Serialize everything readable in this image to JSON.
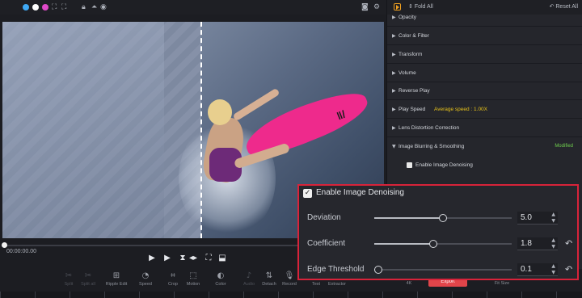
{
  "preview_toolbar": {
    "icons": [
      "record-dot-icon",
      "color-dot-icon",
      "mask-dot-icon",
      "crop-view-icon",
      "split-view-icon",
      "lock-icon",
      "mirror-icon",
      "eye-icon"
    ],
    "right_icons": [
      "snapshot-icon",
      "settings-icon"
    ]
  },
  "player": {
    "timecode": "00:00:00.00",
    "controls": [
      "play-icon",
      "step-play-icon",
      "trim-icon",
      "fullscreen-icon",
      "marker-icon"
    ]
  },
  "toolbar": {
    "items": [
      {
        "label": "Split",
        "icon": "scissors-icon",
        "enabled": false
      },
      {
        "label": "Split all",
        "icon": "split-all-icon",
        "enabled": false
      },
      {
        "label": "Ripple Edit",
        "icon": "ripple-edit-icon",
        "enabled": true
      },
      {
        "label": "Speed",
        "icon": "speed-icon",
        "enabled": true
      },
      {
        "label": "Crop",
        "icon": "crop-icon",
        "enabled": true
      },
      {
        "label": "Motion",
        "icon": "motion-icon",
        "enabled": true
      },
      {
        "label": "Color",
        "icon": "color-icon",
        "enabled": true
      },
      {
        "label": "Audio",
        "icon": "audio-icon",
        "enabled": false
      },
      {
        "label": "Detach",
        "icon": "detach-icon",
        "enabled": true
      },
      {
        "label": "Record",
        "icon": "mic-icon",
        "enabled": true
      },
      {
        "label": "Text",
        "icon": "text-icon",
        "enabled": true
      },
      {
        "label": "Extractor",
        "icon": "extractor-icon",
        "enabled": true
      }
    ],
    "right_labels": [
      "4K",
      "Fit Size"
    ],
    "export_label": "Export"
  },
  "panel": {
    "fold_label": "Fold All",
    "reset_label": "Reset All",
    "sections": [
      {
        "label": "Opacity"
      },
      {
        "label": "Color & Filter"
      },
      {
        "label": "Transform"
      },
      {
        "label": "Volume"
      },
      {
        "label": "Reverse Play"
      },
      {
        "label": "Play Speed",
        "value": "Average speed : 1.00X"
      },
      {
        "label": "Lens Distortion Correction"
      },
      {
        "label": "Image Blurring & Smoothing",
        "status": "Modified",
        "expanded": true
      }
    ],
    "sub_option": "Enable Image Denoising"
  },
  "callout": {
    "title": "Enable Image Denoising",
    "checked": true,
    "params": [
      {
        "label": "Deviation",
        "value": "5.0",
        "level": 0.5,
        "has_reset": false
      },
      {
        "label": "Coefficient",
        "value": "1.8",
        "level": 0.43,
        "has_reset": true
      },
      {
        "label": "Edge Threshold",
        "value": "0.1",
        "level": 0.03,
        "has_reset": true
      }
    ]
  }
}
